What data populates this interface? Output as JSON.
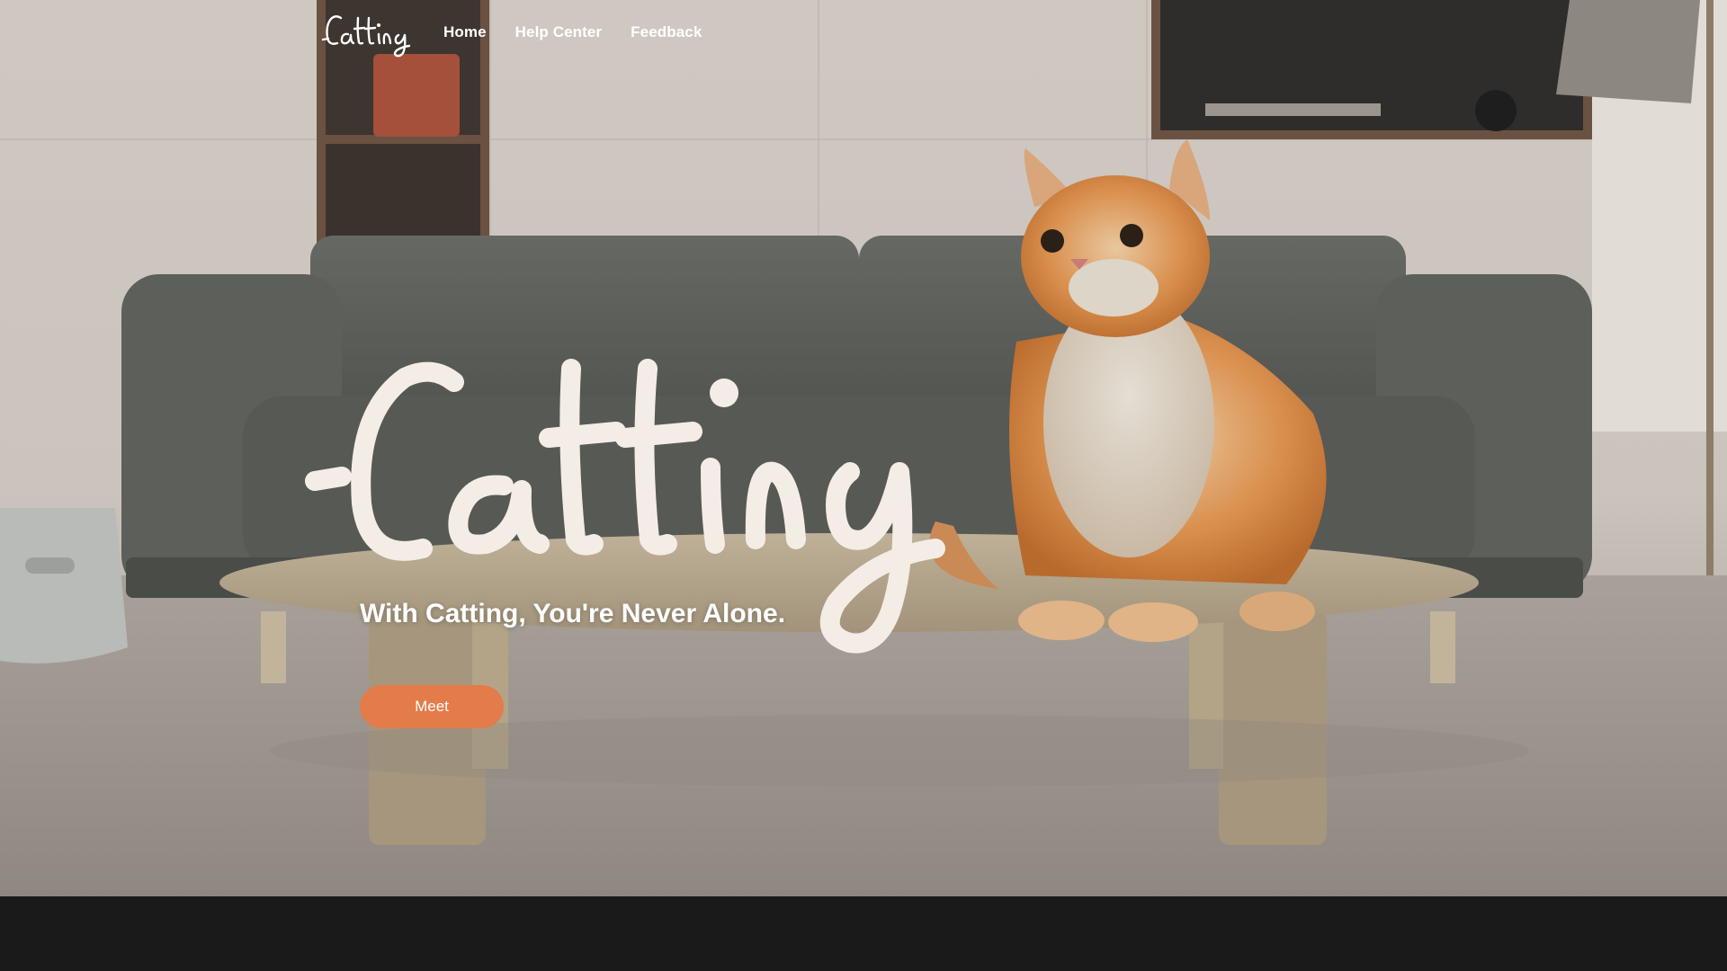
{
  "brand": {
    "logo_text": "Catting",
    "accent": "#e37b4a"
  },
  "nav": {
    "links": [
      "Home",
      "Help Center",
      "Feedback"
    ]
  },
  "hero": {
    "wordmark": "Catting",
    "tagline": "With Catting, You're Never Alone.",
    "cta_label": "Meet"
  },
  "colors": {
    "footer": "#1a1a1b",
    "sofa": "#5b5d58",
    "table": "#b7a88f",
    "cat": "#d78a45"
  }
}
